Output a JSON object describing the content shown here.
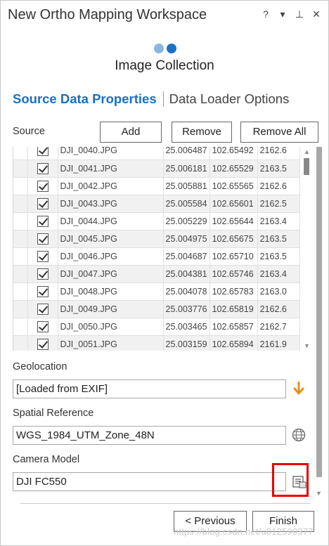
{
  "window": {
    "title": "New Ortho Mapping Workspace",
    "controls": [
      {
        "name": "help-icon",
        "glyph": "?"
      },
      {
        "name": "dropdown-icon",
        "glyph": "▾"
      },
      {
        "name": "pin-icon",
        "glyph": "⊥"
      },
      {
        "name": "close-icon",
        "glyph": "✕"
      }
    ]
  },
  "step": {
    "title": "Image Collection",
    "total": 2,
    "current": 2
  },
  "tabs": {
    "active": "Source Data Properties",
    "inactive": "Data Loader Options"
  },
  "source": {
    "label": "Source",
    "add_label": "Add",
    "remove_label": "Remove",
    "remove_all_label": "Remove All"
  },
  "images": [
    {
      "name": "DJI_0040.JPG",
      "lat": "25.006487",
      "lon": "102.65492",
      "elev": "2162.6"
    },
    {
      "name": "DJI_0041.JPG",
      "lat": "25.006181",
      "lon": "102.65529",
      "elev": "2163.5"
    },
    {
      "name": "DJI_0042.JPG",
      "lat": "25.005881",
      "lon": "102.65565",
      "elev": "2162.6"
    },
    {
      "name": "DJI_0043.JPG",
      "lat": "25.005584",
      "lon": "102.65601",
      "elev": "2162.5"
    },
    {
      "name": "DJI_0044.JPG",
      "lat": "25.005229",
      "lon": "102.65644",
      "elev": "2163.4"
    },
    {
      "name": "DJI_0045.JPG",
      "lat": "25.004975",
      "lon": "102.65675",
      "elev": "2163.5"
    },
    {
      "name": "DJI_0046.JPG",
      "lat": "25.004687",
      "lon": "102.65710",
      "elev": "2163.5"
    },
    {
      "name": "DJI_0047.JPG",
      "lat": "25.004381",
      "lon": "102.65746",
      "elev": "2163.4"
    },
    {
      "name": "DJI_0048.JPG",
      "lat": "25.004078",
      "lon": "102.65783",
      "elev": "2163.0"
    },
    {
      "name": "DJI_0049.JPG",
      "lat": "25.003776",
      "lon": "102.65819",
      "elev": "2162.6"
    },
    {
      "name": "DJI_0050.JPG",
      "lat": "25.003465",
      "lon": "102.65857",
      "elev": "2162.7"
    },
    {
      "name": "DJI_0051.JPG",
      "lat": "25.003159",
      "lon": "102.65894",
      "elev": "2161.9"
    }
  ],
  "geolocation": {
    "label": "Geolocation",
    "value": "[Loaded from EXIF]"
  },
  "spatial_reference": {
    "label": "Spatial Reference",
    "value": "WGS_1984_UTM_Zone_48N"
  },
  "camera_model": {
    "label": "Camera Model",
    "value": "DJI FC550"
  },
  "footer": {
    "previous_label": "< Previous",
    "finish_label": "Finish",
    "watermark": "https://blog.csdn.net/u012599377"
  },
  "colors": {
    "accent": "#1a70c1",
    "step_active": "#1a72c4",
    "step_inactive": "#8ab6e2",
    "highlight": "#e60000",
    "arrow": "#e8921e"
  }
}
